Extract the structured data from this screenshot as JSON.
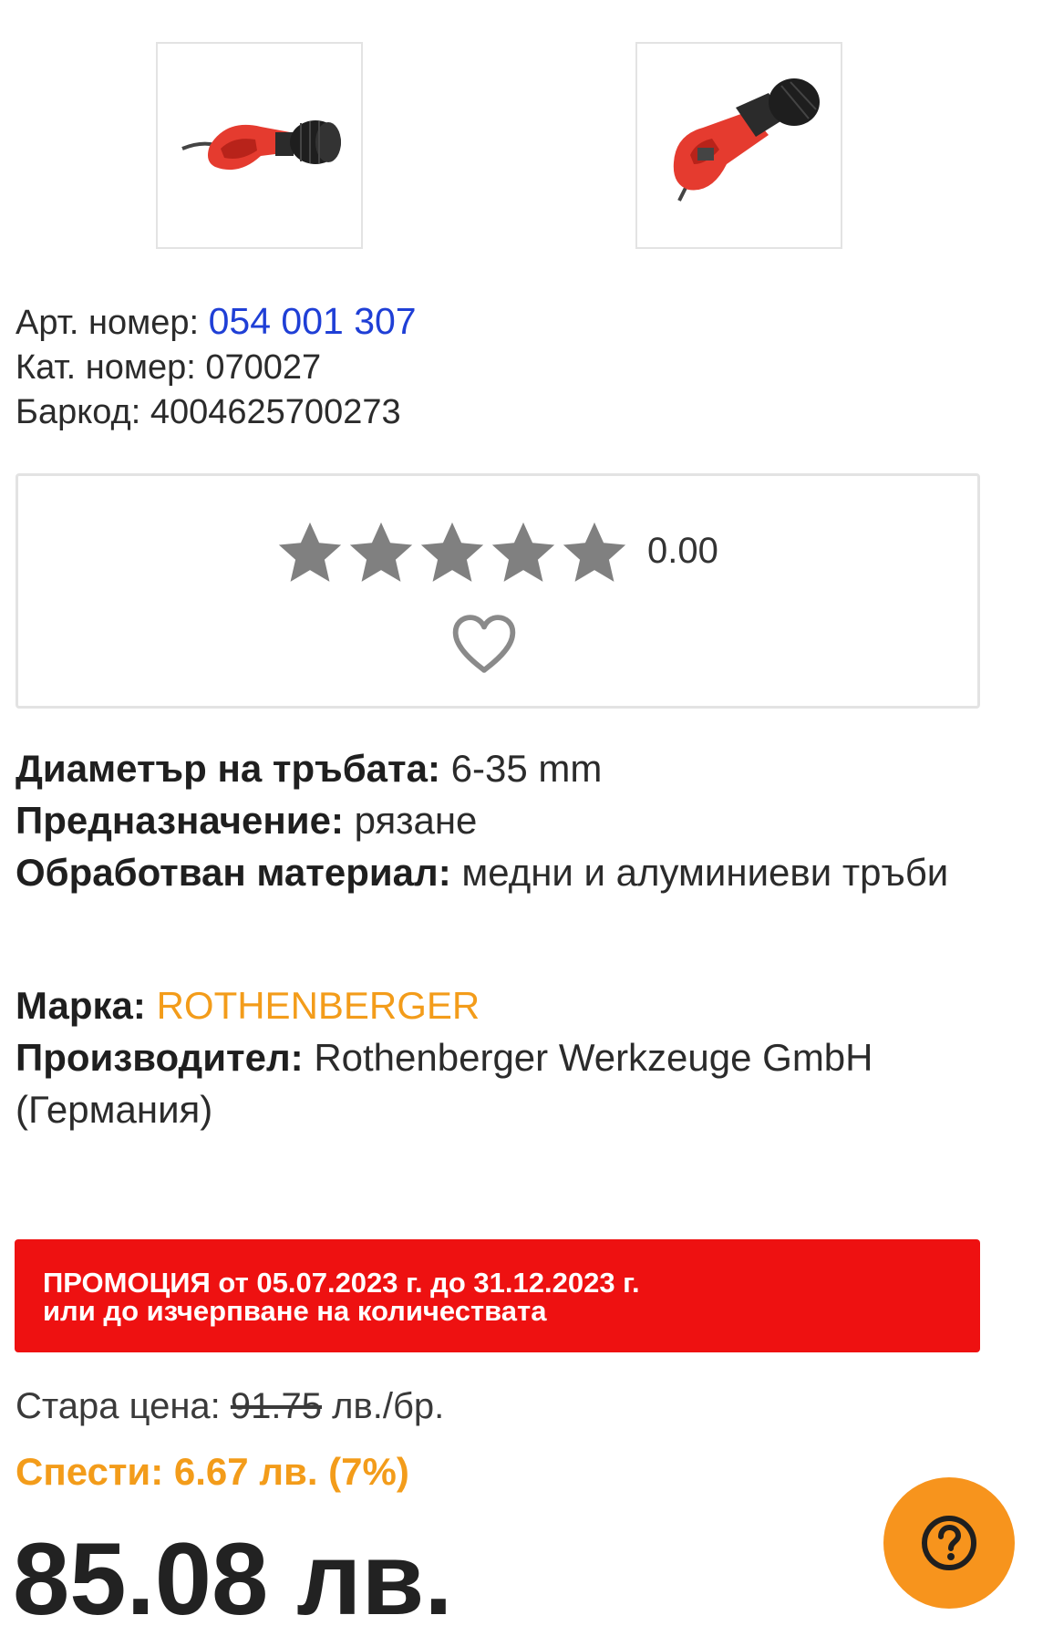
{
  "gallery": {
    "images": [
      {
        "name": "product-thumb-side",
        "color": "#e53b2f"
      },
      {
        "name": "product-thumb-angle",
        "color": "#e53b2f"
      }
    ]
  },
  "codes": {
    "art_label": "Арт. номер:",
    "art_value": "054 001 307",
    "cat_label": "Кат. номер:",
    "cat_value": "070027",
    "barcode_label": "Баркод:",
    "barcode_value": "4004625700273"
  },
  "rating": {
    "stars_filled": 0,
    "stars_total": 5,
    "value": "0.00",
    "star_icon": "star-icon",
    "favorite_icon": "heart-outline-icon"
  },
  "specs": [
    {
      "label": "Диаметър на тръбата:",
      "value": "6-35 mm"
    },
    {
      "label": "Предназначение:",
      "value": "рязане"
    },
    {
      "label": "Обработван материал:",
      "value": "медни и алуминиеви тръби"
    }
  ],
  "brand": {
    "label": "Марка:",
    "value": "ROTHENBERGER",
    "color": "#f39c1a"
  },
  "manufacturer": {
    "label": "Производител:",
    "value": "Rothenberger Werkzeuge GmbH (Германия)"
  },
  "promo": {
    "line1": "ПРОМОЦИЯ от 05.07.2023 г. до 31.12.2023 г.",
    "line2": "или до изчерпване на количествата",
    "color": "#ee1111"
  },
  "pricing": {
    "old_label": "Стара цена:",
    "old_value": "91.75",
    "old_unit": "лв./бр.",
    "save_text": "Спести: 6.67 лв. (7%)",
    "price": "85.08 лв.",
    "accent_color": "#f39c1a"
  },
  "help": {
    "icon": "question-circle-icon",
    "color": "#f7941d"
  }
}
